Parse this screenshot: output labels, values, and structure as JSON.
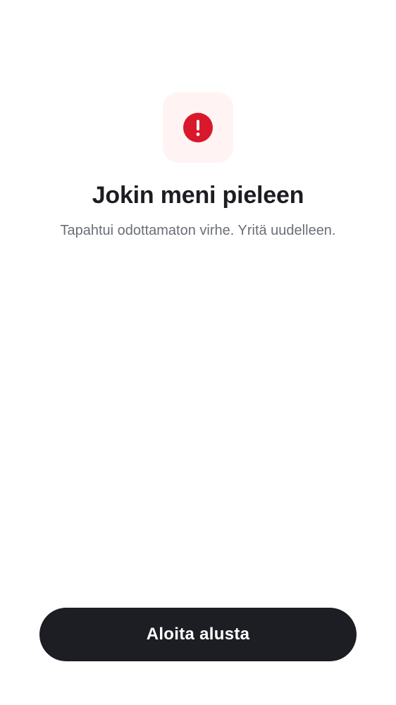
{
  "colors": {
    "background": "#ffffff",
    "icon_tile_bg": "#fff4f3",
    "alert_red": "#d9182b",
    "title_text": "#1c1d22",
    "subtitle_text": "#6b6e78",
    "button_bg": "#1d1e23",
    "button_text": "#ffffff"
  },
  "error": {
    "icon": "exclamation-circle-icon",
    "title": "Jokin meni pieleen",
    "message": "Tapahtui odottamaton virhe. Yritä uudelleen."
  },
  "actions": {
    "restart_label": "Aloita alusta"
  }
}
